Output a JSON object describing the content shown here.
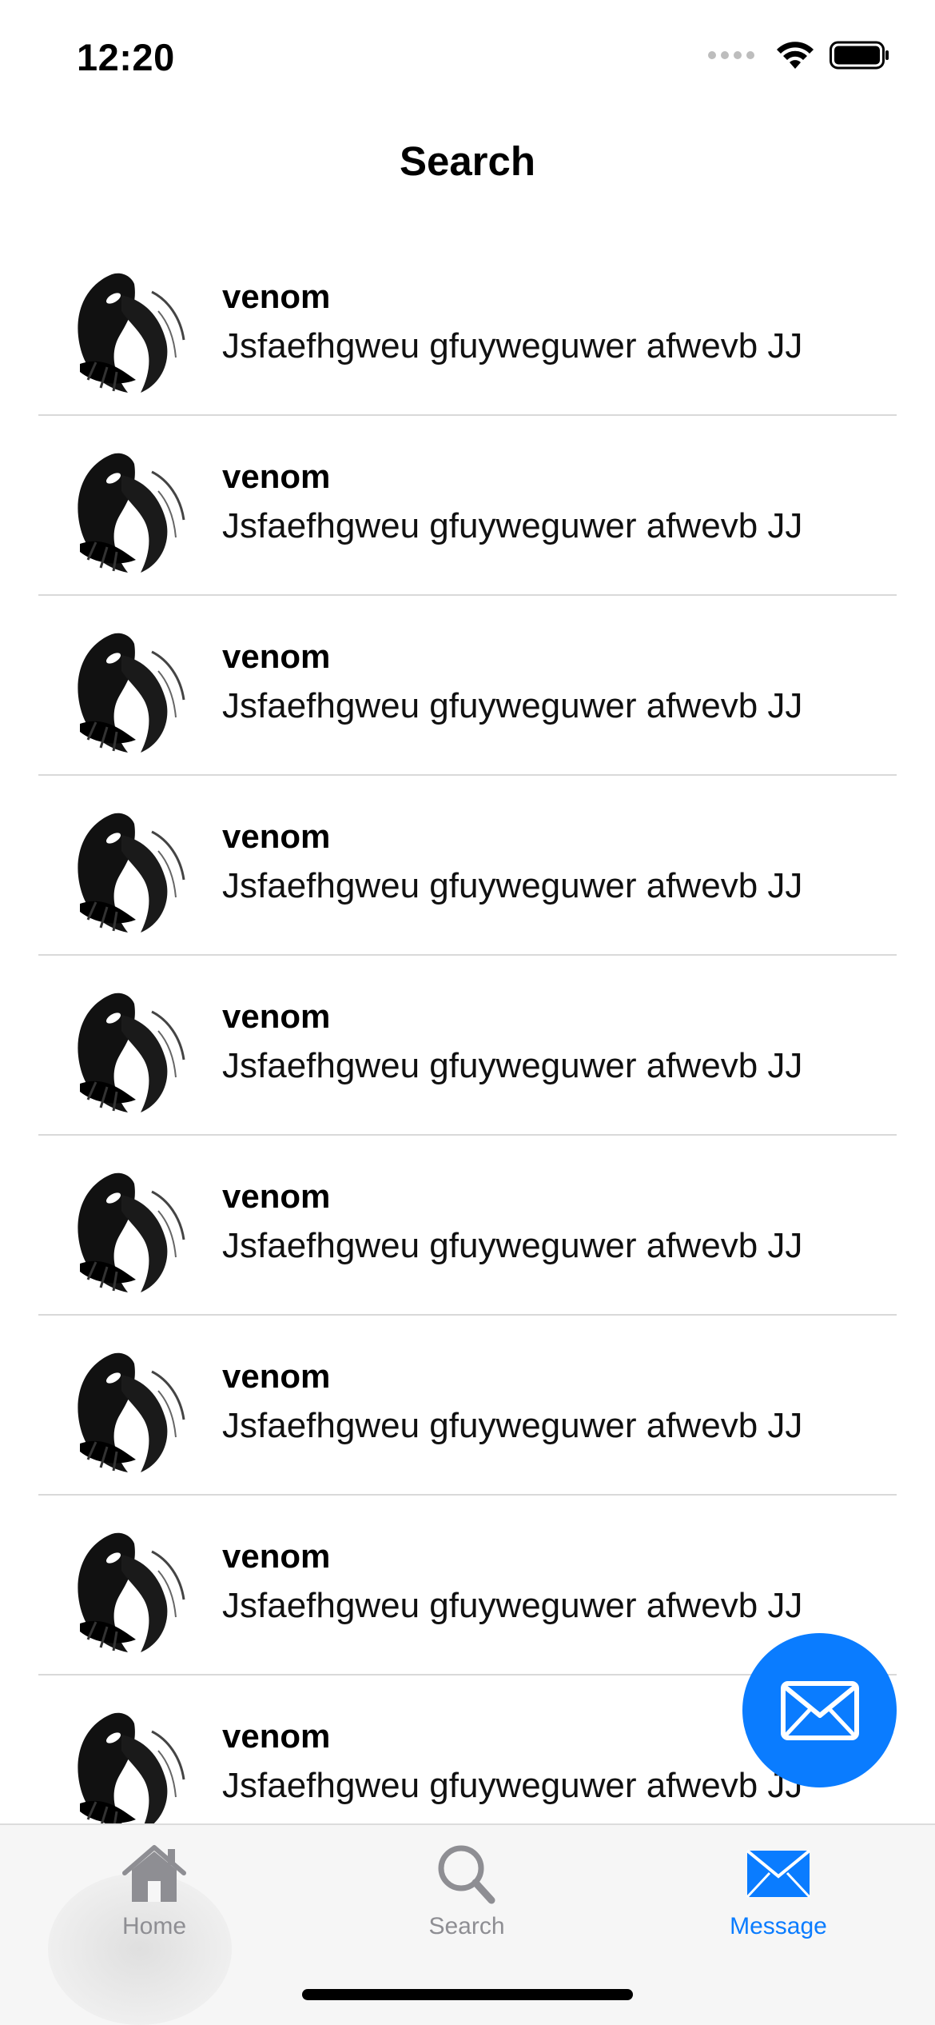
{
  "status_bar": {
    "time": "12:20"
  },
  "nav": {
    "title": "Search"
  },
  "list": {
    "items": [
      {
        "name": "venom",
        "message": "Jsfaefhgweu gfuyweguwer afwevb JJ"
      },
      {
        "name": "venom",
        "message": "Jsfaefhgweu gfuyweguwer afwevb JJ"
      },
      {
        "name": "venom",
        "message": "Jsfaefhgweu gfuyweguwer afwevb JJ"
      },
      {
        "name": "venom",
        "message": "Jsfaefhgweu gfuyweguwer afwevb JJ"
      },
      {
        "name": "venom",
        "message": "Jsfaefhgweu gfuyweguwer afwevb JJ"
      },
      {
        "name": "venom",
        "message": "Jsfaefhgweu gfuyweguwer afwevb JJ"
      },
      {
        "name": "venom",
        "message": "Jsfaefhgweu gfuyweguwer afwevb JJ"
      },
      {
        "name": "venom",
        "message": "Jsfaefhgweu gfuyweguwer afwevb JJ"
      },
      {
        "name": "venom",
        "message": "Jsfaefhgweu gfuyweguwer afwevb JJ"
      }
    ]
  },
  "fab": {
    "icon": "envelope-icon"
  },
  "tabs": [
    {
      "label": "Home",
      "icon": "house-icon",
      "active": false
    },
    {
      "label": "Search",
      "icon": "magnifier-icon",
      "active": false
    },
    {
      "label": "Message",
      "icon": "envelope-icon",
      "active": true
    }
  ],
  "colors": {
    "accent": "#0a7cff",
    "inactive": "#8e8e93",
    "divider": "#d9d9d9"
  }
}
